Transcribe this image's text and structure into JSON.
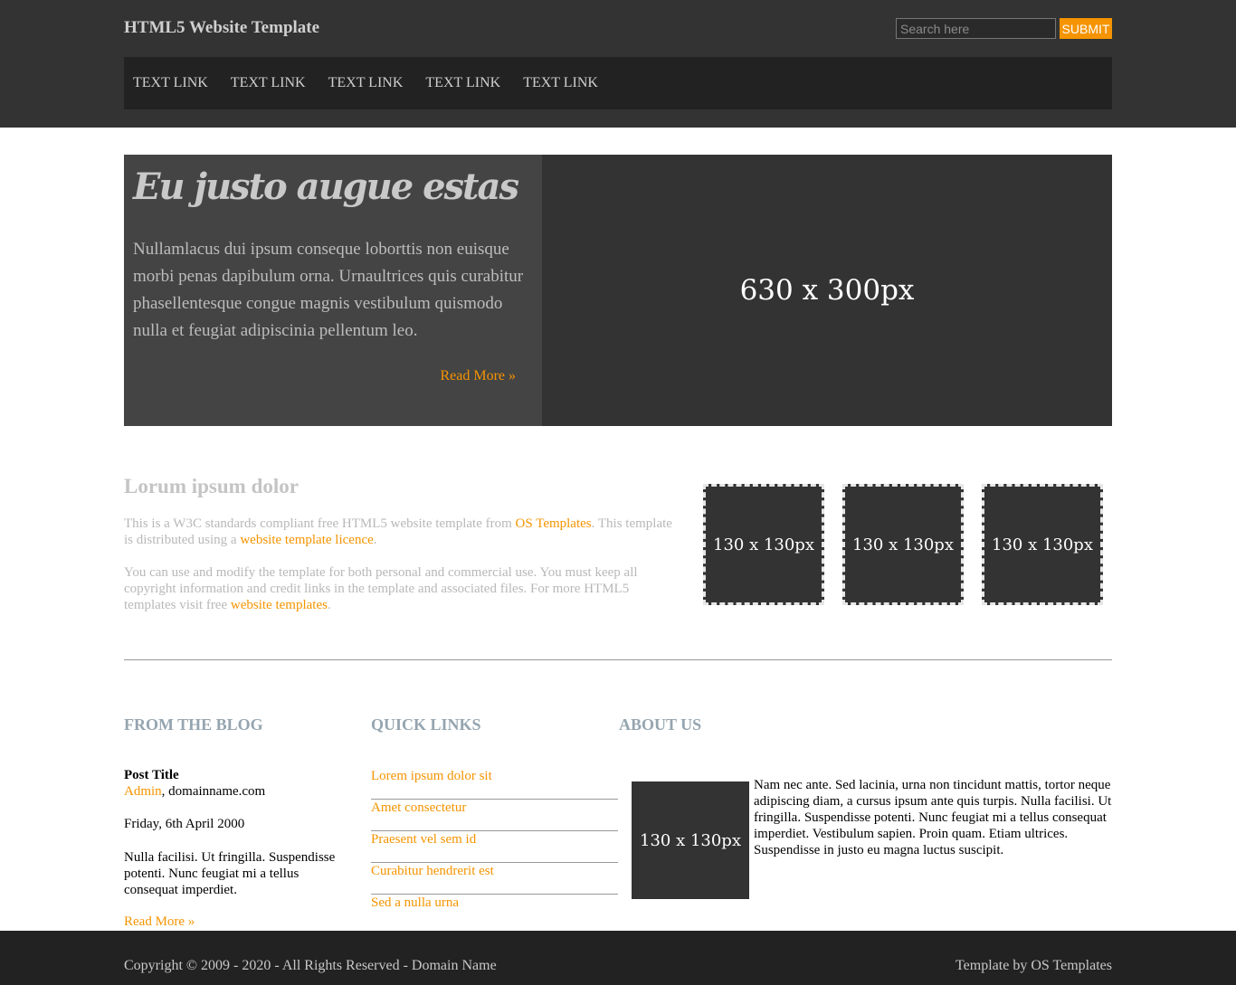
{
  "header": {
    "site_title": "HTML5 Website Template",
    "search_placeholder": "Search here",
    "submit_label": "SUBMIT"
  },
  "nav": {
    "items": [
      {
        "label": "TEXT LINK"
      },
      {
        "label": "TEXT LINK"
      },
      {
        "label": "TEXT LINK"
      },
      {
        "label": "TEXT LINK"
      },
      {
        "label": "TEXT LINK"
      }
    ]
  },
  "featured": {
    "heading": "Eu justo augue estas",
    "text": "Nullamlacus dui ipsum conseque loborttis non euisque morbi penas dapibulum orna. Urnaultrices quis curabitur phasellentesque congue magnis vestibulum quismodo nulla et feugiat adipiscinia pellentum leo.",
    "read_more": "Read More »",
    "image_label": "630 x 300px"
  },
  "intro": {
    "heading": "Lorum ipsum dolor",
    "p1_a": "This is a W3C standards compliant free HTML5 website template from ",
    "p1_link1": "OS Templates",
    "p1_b": ". This template is distributed using a ",
    "p1_link2": "website template licence",
    "p1_c": ".",
    "p2_a": "You can use and modify the template for both personal and commercial use. You must keep all copyright information and credit links in the template and associated files. For more HTML5 templates visit free ",
    "p2_link": "website templates",
    "p2_b": ".",
    "thumbs": [
      {
        "label": "130 x 130px"
      },
      {
        "label": "130 x 130px"
      },
      {
        "label": "130 x 130px"
      }
    ]
  },
  "blog": {
    "title": "FROM THE BLOG",
    "post_title": "Post Title",
    "author_link": "Admin",
    "author_rest": ", domainname.com",
    "date": "Friday, 6th April 2000",
    "excerpt": "Nulla facilisi. Ut fringilla. Suspendisse potenti. Nunc feugiat mi a tellus consequat imperdiet.",
    "read_more": "Read More »"
  },
  "quick_links": {
    "title": "QUICK LINKS",
    "items": [
      {
        "label": "Lorem ipsum dolor sit"
      },
      {
        "label": "Amet consectetur"
      },
      {
        "label": "Praesent vel sem id"
      },
      {
        "label": "Curabitur hendrerit est"
      },
      {
        "label": "Sed a nulla urna"
      }
    ]
  },
  "about": {
    "title": "ABOUT US",
    "image_label": "130 x 130px",
    "text": "Nam nec ante. Sed lacinia, urna non tincidunt mattis, tortor neque adipiscing diam, a cursus ipsum ante quis turpis. Nulla facilisi. Ut fringilla. Suspendisse potenti. Nunc feugiat mi a tellus consequat imperdiet. Vestibulum sapien. Proin quam. Etiam ultrices. Suspendisse in justo eu magna luctus suscipit."
  },
  "footer": {
    "copyright": "Copyright © 2009 - 2020 - All Rights Reserved - Domain Name",
    "credit": "Template by OS Templates"
  },
  "colors": {
    "accent": "#f59400",
    "header_bg": "#333333",
    "nav_bg": "#222222",
    "heading_blue": "#95a5b0"
  }
}
